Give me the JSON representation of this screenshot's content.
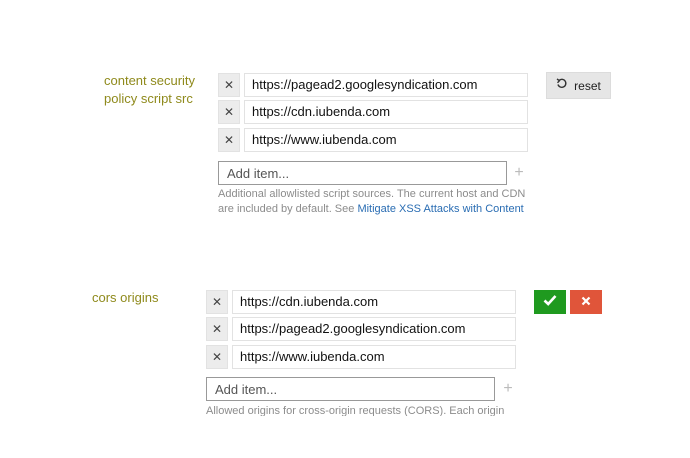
{
  "csp": {
    "label_line1": "content security",
    "label_line2": "policy script src",
    "items": [
      "https://pagead2.googlesyndication.com",
      "https://cdn.iubenda.com",
      "https://www.iubenda.com"
    ],
    "add_placeholder": "Add item...",
    "help_text": "Additional allowlisted script sources. The current host and CDN are included by default. See ",
    "help_link": "Mitigate XSS Attacks with Content",
    "reset_label": "reset"
  },
  "cors": {
    "label": "cors origins",
    "items": [
      "https://cdn.iubenda.com",
      "https://pagead2.googlesyndication.com",
      "https://www.iubenda.com"
    ],
    "add_placeholder": "Add item...",
    "help_text": "Allowed origins for cross-origin requests (CORS). Each origin"
  },
  "colors": {
    "label": "#8f8a1c",
    "save_green": "#1f9a1f",
    "cancel_red": "#e0553a",
    "link_blue": "#2a6db3"
  }
}
